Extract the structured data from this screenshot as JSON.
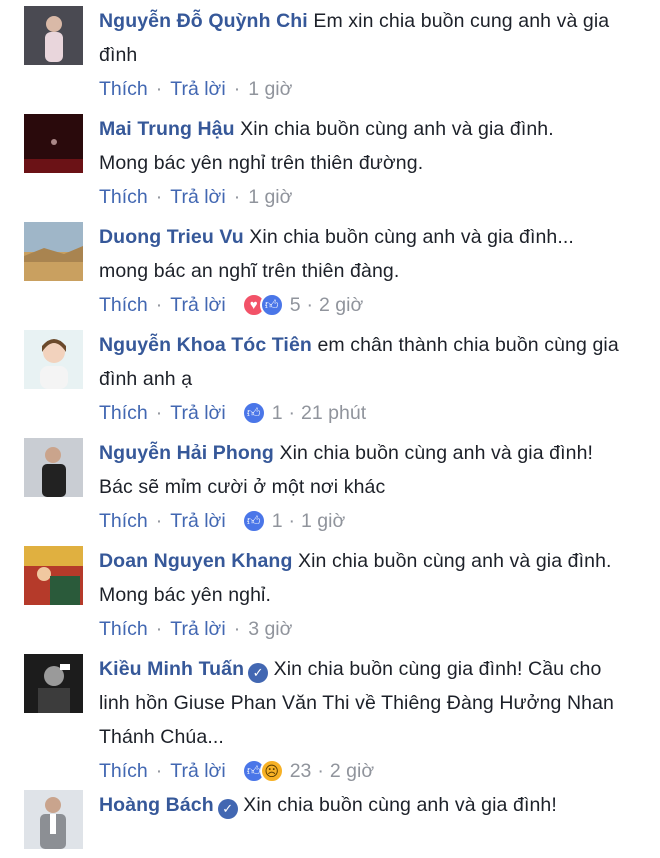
{
  "action_labels": {
    "like": "Thích",
    "reply": "Trả lời",
    "separator": "·"
  },
  "colors": {
    "author": "#365899",
    "link": "#4267b2",
    "meta": "#90949c",
    "like": "#4a76e8",
    "love": "#f25268",
    "sad": "#f7b125"
  },
  "comments": [
    {
      "author": "Nguyễn Đỗ Quỳnh Chi",
      "verified": false,
      "text": "Em xin chia buồn cung anh và gia đình",
      "reactions": [],
      "reaction_count": "",
      "time": "1 giờ",
      "avatar": {
        "bg": "#4a4a52",
        "desc": "woman-portrait"
      }
    },
    {
      "author": "Mai Trung Hậu",
      "verified": false,
      "text": "Xin chia buồn cùng anh và gia đình. Mong bác yên nghỉ trên thiên đường.",
      "reactions": [],
      "reaction_count": "",
      "time": "1 giờ",
      "avatar": {
        "bg": "#2a0a0c",
        "desc": "dark-stage"
      }
    },
    {
      "author": "Duong Trieu Vu",
      "verified": false,
      "text": "Xin chia buồn cùng anh và gia đình... mong bác an nghĩ trên thiên đàng.",
      "reactions": [
        "love-icon",
        "like-icon"
      ],
      "reaction_count": "5",
      "time": "2 giờ",
      "avatar": {
        "bg": "#9fb6c8",
        "desc": "landscape"
      }
    },
    {
      "author": "Nguyễn Khoa Tóc Tiên",
      "verified": false,
      "text": "em chân thành chia buồn cùng gia đình anh ạ",
      "reactions": [
        "like-icon"
      ],
      "reaction_count": "1",
      "time": "21 phút",
      "avatar": {
        "bg": "#e8f2f3",
        "desc": "woman-portrait"
      }
    },
    {
      "author": "Nguyễn Hải Phong",
      "verified": false,
      "text": "Xin chia buồn cùng anh và gia đình! Bác sẽ mỉm cười ở một nơi khác",
      "reactions": [
        "like-icon"
      ],
      "reaction_count": "1",
      "time": "1 giờ",
      "avatar": {
        "bg": "#c9cdd3",
        "desc": "man-portrait"
      }
    },
    {
      "author": "Doan Nguyen Khang",
      "verified": false,
      "text": "Xin chia buồn cùng anh và gia đình. Mong bác yên nghỉ.",
      "reactions": [],
      "reaction_count": "",
      "time": "3 giờ",
      "avatar": {
        "bg": "#b53a2a",
        "desc": "colorful-photo"
      }
    },
    {
      "author": "Kiều Minh Tuấn",
      "verified": true,
      "text": "Xin chia buồn cùng gia đình! Cầu cho linh hồn Giuse Phan Văn Thi về Thiêng Đàng Hưởng Nhan Thánh Chúa...",
      "reactions": [
        "like-icon",
        "sad-icon"
      ],
      "reaction_count": "23",
      "time": "2 giờ",
      "avatar": {
        "bg": "#1c1c1c",
        "desc": "bw-portrait"
      }
    },
    {
      "author": "Hoàng Bách",
      "verified": true,
      "text": "Xin chia buồn cùng anh và gia đình!",
      "reactions": [],
      "reaction_count": "",
      "time": "",
      "avatar": {
        "bg": "#dfe3e8",
        "desc": "man-suit"
      }
    }
  ]
}
